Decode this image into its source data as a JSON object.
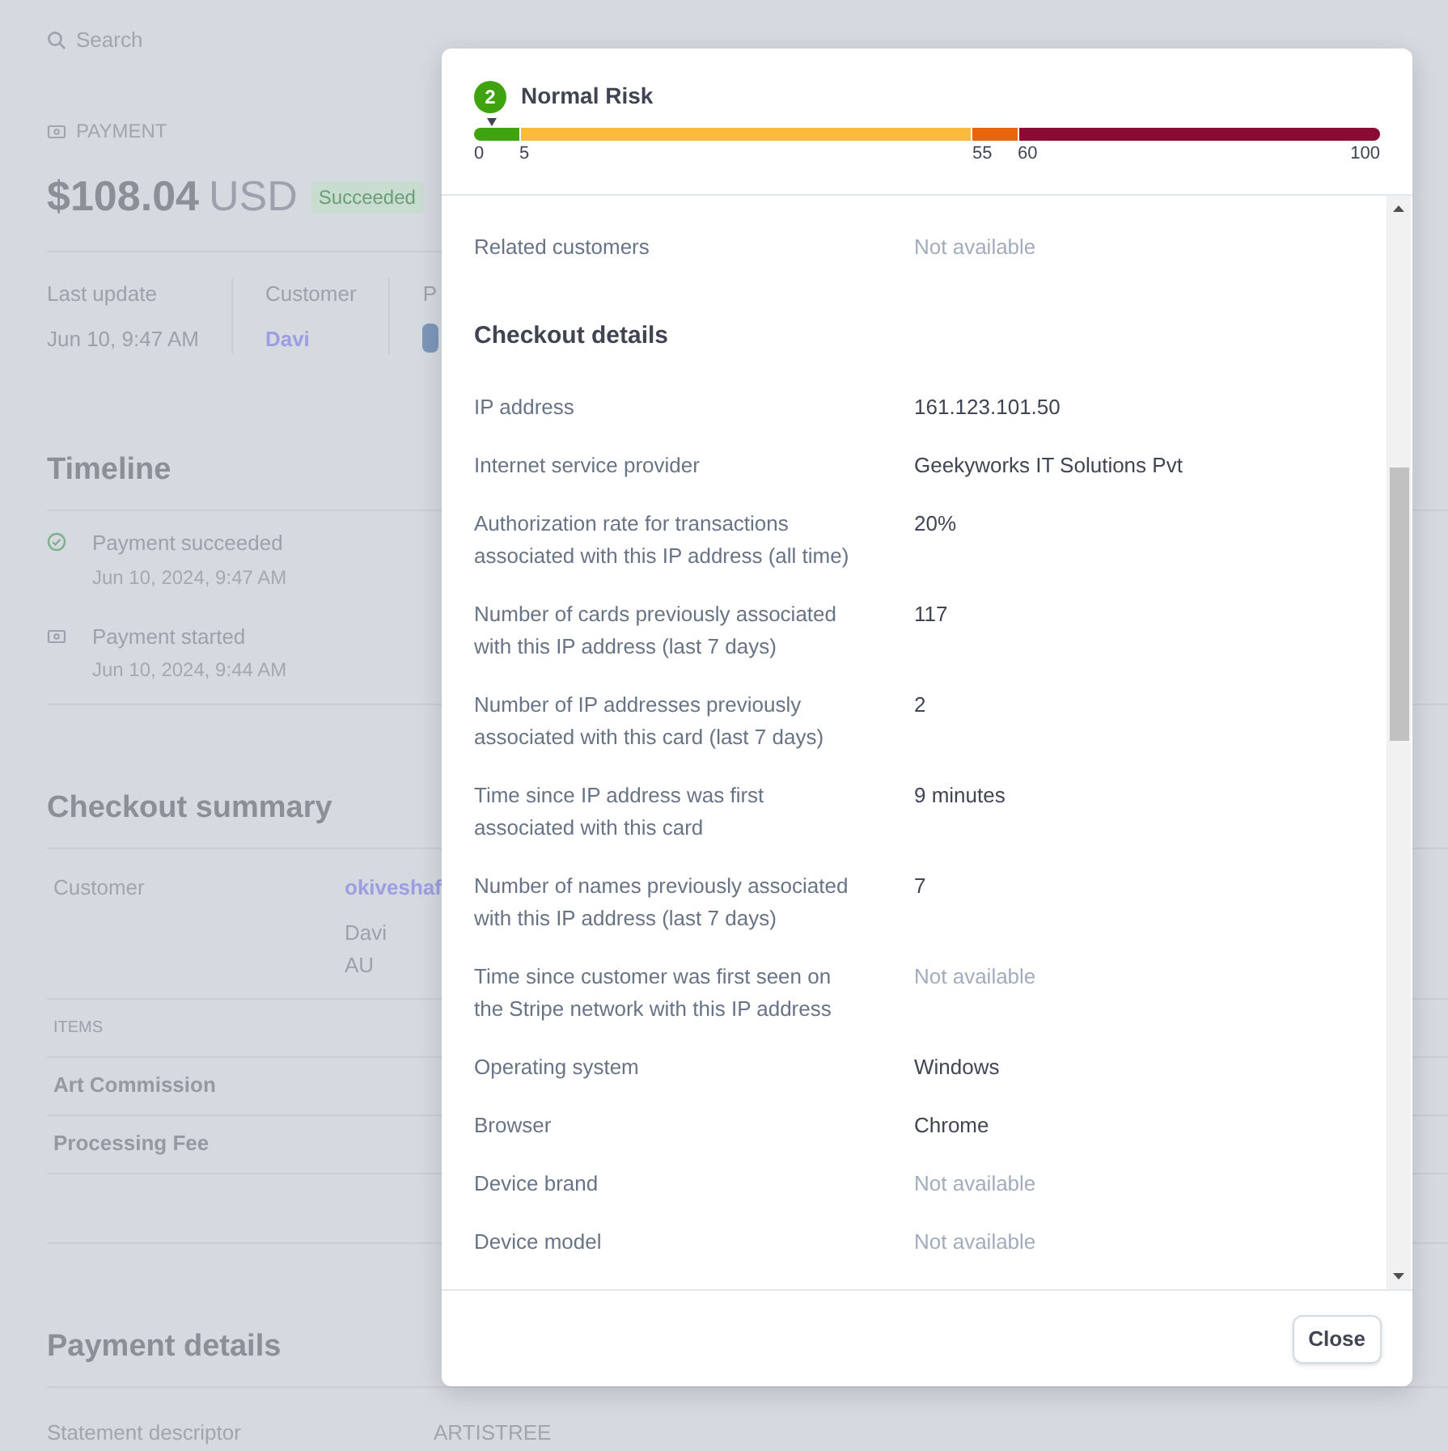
{
  "page": {
    "search": {
      "placeholder": "Search"
    },
    "payment": {
      "label": "PAYMENT",
      "amount": "$108.04",
      "currency": "USD",
      "status": "Succeeded"
    },
    "summary_fields": [
      {
        "label": "Last update",
        "value": "Jun 10, 9:47 AM",
        "kind": "text"
      },
      {
        "label": "Customer",
        "value": "Davi",
        "kind": "link"
      },
      {
        "label": "P",
        "kind": "chip"
      }
    ],
    "timeline": {
      "title": "Timeline",
      "events": [
        {
          "title": "Payment succeeded",
          "time": "Jun 10, 2024, 9:47 AM",
          "kind": "success"
        },
        {
          "title": "Payment started",
          "time": "Jun 10, 2024, 9:44 AM",
          "kind": "payment"
        }
      ]
    },
    "checkout_summary": {
      "title": "Checkout summary",
      "customer_label": "Customer",
      "customer_link": "okiveshaf",
      "customer_lines": [
        "Davi",
        "AU"
      ],
      "items_heading": "ITEMS",
      "items": [
        "Art Commission",
        "Processing Fee"
      ]
    },
    "payment_details": {
      "title": "Payment details",
      "rows": [
        {
          "label": "Statement descriptor",
          "value": "ARTISTREE"
        }
      ]
    }
  },
  "modal": {
    "risk": {
      "score": "2",
      "label": "Normal Risk",
      "level": 0.02,
      "ticks": [
        "0",
        "5",
        "55",
        "60",
        "100"
      ],
      "segments": [
        {
          "color": "#3fa30f"
        },
        {
          "color": "#fbbb3a"
        },
        {
          "color": "#e8650c"
        },
        {
          "color": "#8a0c35"
        }
      ]
    },
    "rows": [
      {
        "kind": "row",
        "label": "Related customers",
        "value": "Not available",
        "muted": true
      },
      {
        "kind": "heading",
        "label": "Checkout details"
      },
      {
        "kind": "row",
        "label": "IP address",
        "value": "161.123.101.50",
        "muted": false
      },
      {
        "kind": "row",
        "label": "Internet service provider",
        "value": "Geekyworks IT Solutions Pvt",
        "muted": false
      },
      {
        "kind": "row",
        "label": "Authorization rate for transactions associated with this IP address (all time)",
        "value": "20%",
        "muted": false
      },
      {
        "kind": "row",
        "label": "Number of cards previously associated with this IP address (last 7 days)",
        "value": "117",
        "muted": false
      },
      {
        "kind": "row",
        "label": "Number of IP addresses previously associated with this card (last 7 days)",
        "value": "2",
        "muted": false
      },
      {
        "kind": "row",
        "label": "Time since IP address was first associated with this card",
        "value": "9 minutes",
        "muted": false
      },
      {
        "kind": "row",
        "label": "Number of names previously associated with this IP address (last 7 days)",
        "value": "7",
        "muted": false
      },
      {
        "kind": "row",
        "label": "Time since customer was first seen on the Stripe network with this IP address",
        "value": "Not available",
        "muted": true
      },
      {
        "kind": "row",
        "label": "Operating system",
        "value": "Windows",
        "muted": false
      },
      {
        "kind": "row",
        "label": "Browser",
        "value": "Chrome",
        "muted": false
      },
      {
        "kind": "row",
        "label": "Device brand",
        "value": "Not available",
        "muted": true
      },
      {
        "kind": "row",
        "label": "Device model",
        "value": "Not available",
        "muted": true
      }
    ],
    "close": "Close"
  }
}
